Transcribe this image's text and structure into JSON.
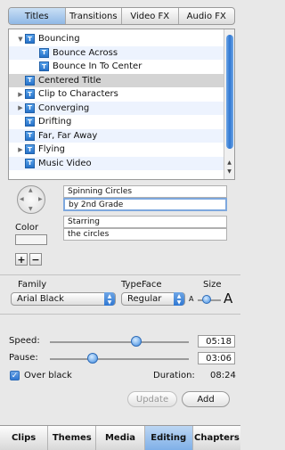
{
  "tabs": [
    {
      "label": "Titles",
      "active": true
    },
    {
      "label": "Transitions",
      "active": false
    },
    {
      "label": "Video FX",
      "active": false
    },
    {
      "label": "Audio FX",
      "active": false
    }
  ],
  "titles_list": [
    {
      "label": "Bouncing",
      "expander": "open"
    },
    {
      "label": "Bounce Across",
      "child": true
    },
    {
      "label": "Bounce In To Center",
      "child": true
    },
    {
      "label": "Centered Title",
      "selected": true
    },
    {
      "label": "Clip to Characters",
      "expander": "closed"
    },
    {
      "label": "Converging",
      "expander": "closed"
    },
    {
      "label": "Drifting"
    },
    {
      "label": "Far, Far Away"
    },
    {
      "label": "Flying",
      "expander": "closed"
    },
    {
      "label": "Music Video"
    }
  ],
  "editor": {
    "color_label": "Color",
    "add_line": "+",
    "remove_line": "−",
    "lines": [
      {
        "value": "Spinning Circles"
      },
      {
        "value": "by 2nd Grade",
        "focused": true
      },
      {
        "value": "Starring"
      },
      {
        "value": "the circles"
      }
    ]
  },
  "font": {
    "family_label": "Family",
    "family_value": "Arial Black",
    "typeface_label": "TypeFace",
    "typeface_value": "Regular",
    "size_label": "Size",
    "size_small": "A",
    "size_large": "A",
    "size_level": 0.4
  },
  "timing": {
    "speed_label": "Speed:",
    "speed_value": "05:18",
    "speed_level": 0.62,
    "pause_label": "Pause:",
    "pause_value": "03:06",
    "pause_level": 0.31,
    "over_black_label": "Over black",
    "over_black_checked": true,
    "duration_label": "Duration:",
    "duration_value": "08:24"
  },
  "buttons": {
    "update": "Update",
    "add": "Add"
  },
  "bottom_tabs": [
    {
      "label": "Clips",
      "active": false
    },
    {
      "label": "Themes",
      "active": false
    },
    {
      "label": "Media",
      "active": false
    },
    {
      "label": "Editing",
      "active": true
    },
    {
      "label": "Chapters",
      "active": false
    }
  ],
  "colors": {
    "accent": "#2f77d2",
    "selection": "#d4d4d4",
    "alt_row": "#edf3fe"
  }
}
